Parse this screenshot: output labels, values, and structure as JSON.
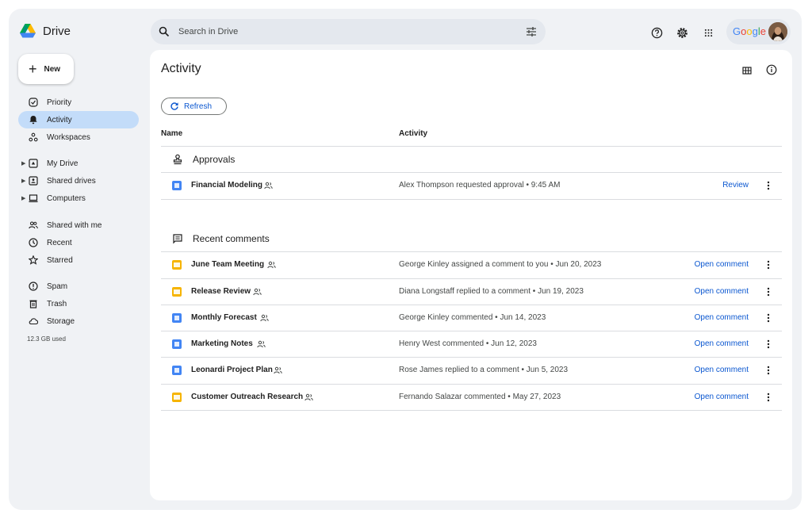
{
  "app": {
    "name": "Drive"
  },
  "search": {
    "placeholder": "Search in Drive"
  },
  "header": {
    "account_label": "Google"
  },
  "sidebar": {
    "new_label": "New",
    "items": [
      {
        "label": "Priority",
        "icon": "priority-icon"
      },
      {
        "label": "Activity",
        "icon": "bell-icon",
        "active": true
      },
      {
        "label": "Workspaces",
        "icon": "workspaces-icon"
      },
      {
        "label": "My Drive",
        "icon": "my-drive-icon"
      },
      {
        "label": "Shared drives",
        "icon": "shared-drives-icon"
      },
      {
        "label": "Computers",
        "icon": "computer-icon"
      },
      {
        "label": "Shared with me",
        "icon": "shared-with-me-icon"
      },
      {
        "label": "Recent",
        "icon": "clock-icon"
      },
      {
        "label": "Starred",
        "icon": "star-icon"
      },
      {
        "label": "Spam",
        "icon": "spam-icon"
      },
      {
        "label": "Trash",
        "icon": "trash-icon"
      },
      {
        "label": "Storage",
        "icon": "cloud-icon"
      }
    ],
    "storage_used": "12.3 GB used"
  },
  "main": {
    "title": "Activity",
    "refresh_label": "Refresh",
    "columns": {
      "name": "Name",
      "activity": "Activity"
    },
    "approvals": {
      "heading": "Approvals",
      "rows": [
        {
          "name": "Financial Modeling",
          "type": "doc",
          "activity": "Alex Thompson requested approval • 9:45 AM",
          "action": "Review"
        }
      ]
    },
    "comments": {
      "heading": "Recent comments",
      "rows": [
        {
          "name": "June Team Meeting",
          "type": "slides",
          "activity": "George Kinley assigned a comment to you • Jun 20, 2023",
          "action": "Open comment"
        },
        {
          "name": "Release Review",
          "type": "slides",
          "activity": "Diana Longstaff replied to a comment • Jun 19, 2023",
          "action": "Open comment"
        },
        {
          "name": "Monthly Forecast",
          "type": "doc",
          "activity": "George Kinley commented • Jun 14, 2023",
          "action": "Open comment"
        },
        {
          "name": "Marketing Notes",
          "type": "doc",
          "activity": "Henry West commented • Jun 12, 2023",
          "action": "Open comment"
        },
        {
          "name": "Leonardi Project Plan",
          "type": "doc",
          "activity": "Rose James replied to a comment • Jun 5, 2023",
          "action": "Open comment"
        },
        {
          "name": "Customer Outreach Research",
          "type": "slides",
          "activity": "Fernando Salazar commented • May 27, 2023",
          "action": "Open comment"
        }
      ]
    }
  },
  "colors": {
    "accent": "#0b57d0",
    "active_nav": "#c3dcf9",
    "doc": "#4285f4",
    "slides": "#f6b400",
    "background": "#f0f2f5"
  }
}
